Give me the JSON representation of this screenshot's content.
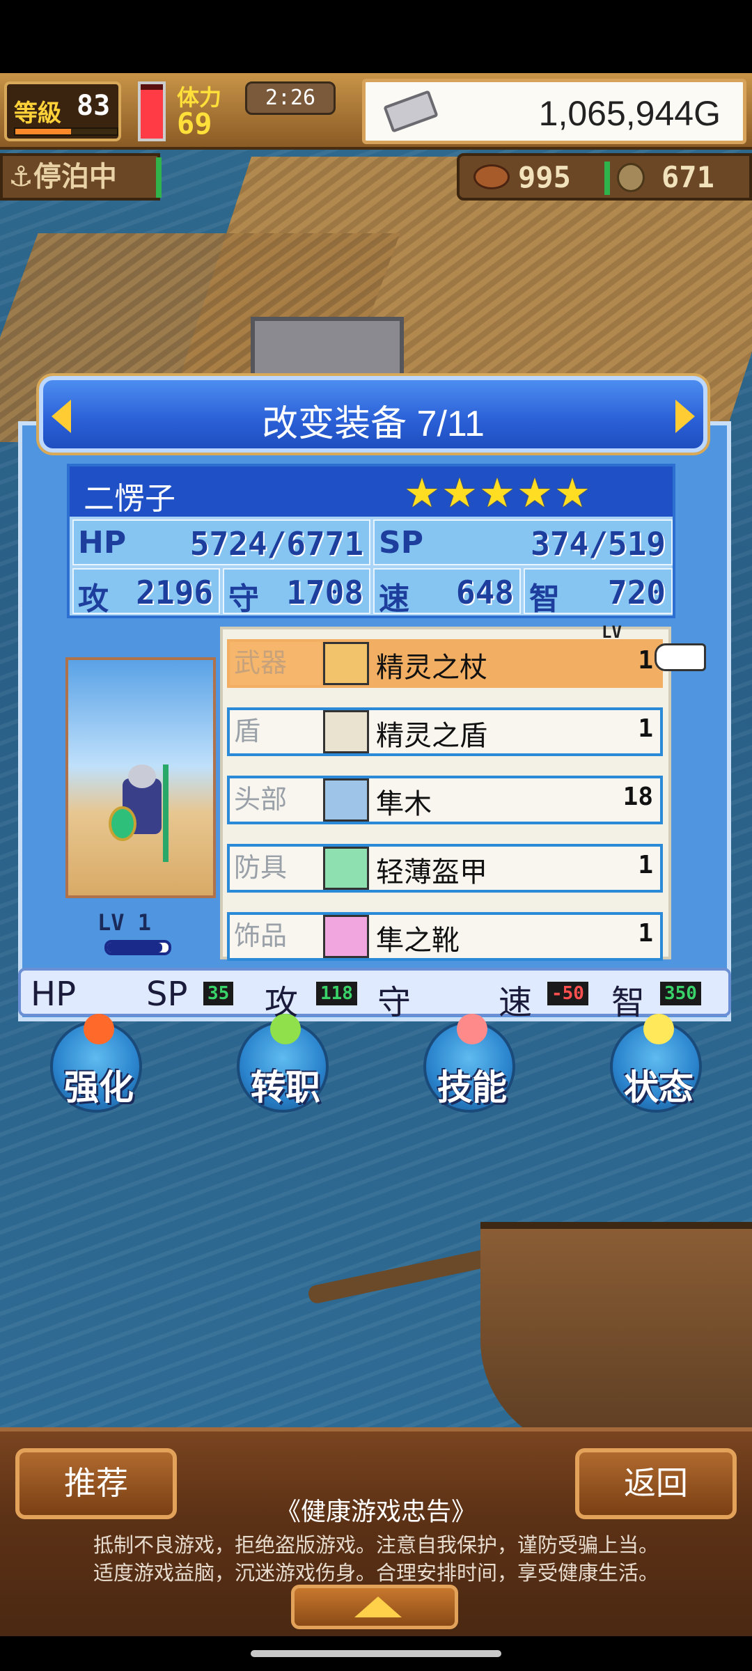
{
  "hud": {
    "level_label": "等級",
    "level_value": "83",
    "exp_fraction": 0.55,
    "stamina_label": "体力",
    "stamina_value": "69",
    "stamina_fraction": 0.9,
    "time": "2:26",
    "gold": "1,065,944G",
    "status": "停泊中",
    "food": "995",
    "wood": "671"
  },
  "dialog": {
    "title": "改变装备 7/11",
    "character": {
      "name": "二愣子",
      "stars": "★★★★★",
      "star_count": 5,
      "hp_label": "HP",
      "hp": "5724/6771",
      "sp_label": "SP",
      "sp": "374/519",
      "atk_label": "攻",
      "atk": "2196",
      "def_label": "守",
      "def": "1708",
      "spd_label": "速",
      "spd": "648",
      "int_label": "智",
      "int": "720",
      "lv_tag": "LV  1",
      "lv_fraction": 0.9
    },
    "equipment": {
      "lv_header": "LV",
      "slots": [
        {
          "slot": "武器",
          "item": "精灵之杖",
          "level": "1",
          "icon": "staff-icon",
          "icon_color": "#f2c36a"
        },
        {
          "slot": "盾",
          "item": "精灵之盾",
          "level": "1",
          "icon": "shield-icon",
          "icon_color": "#e9e3cf"
        },
        {
          "slot": "头部",
          "item": "隼木",
          "level": "18",
          "icon": "helmet-icon",
          "icon_color": "#9ec4e8"
        },
        {
          "slot": "防具",
          "item": "轻薄盔甲",
          "level": "1",
          "icon": "armor-icon",
          "icon_color": "#8fe0b0"
        },
        {
          "slot": "饰品",
          "item": "隼之靴",
          "level": "1",
          "icon": "boots-icon",
          "icon_color": "#f2a6e0"
        }
      ]
    },
    "bonus": {
      "hp_label": "HP",
      "sp_label": "SP",
      "sp_value": "35",
      "atk_label": "攻",
      "atk_value": "118",
      "def_label": "守",
      "spd_label": "速",
      "spd_value": "-50",
      "int_label": "智",
      "int_value": "350"
    }
  },
  "actions": [
    {
      "label": "强化",
      "icon": "arrow-up-icon",
      "color": "#ff6a2a"
    },
    {
      "label": "转职",
      "icon": "leaf-icon",
      "color": "#8fe04a"
    },
    {
      "label": "技能",
      "icon": "flame-icon",
      "color": "#ff8a8a"
    },
    {
      "label": "状态",
      "icon": "sparkle-icon",
      "color": "#ffe95a"
    }
  ],
  "footer": {
    "recommend": "推荐",
    "back": "返回",
    "notice_title": "《健康游戏忠告》",
    "notice_line1": "抵制不良游戏，拒绝盗版游戏。注意自我保护，谨防受骗上当。",
    "notice_line2": "适度游戏益脑，沉迷游戏伤身。合理安排时间，享受健康生活。"
  },
  "colors": {
    "dialog_blue": "#4f95df",
    "title_blue": "#2a5fd6",
    "selected_row": "#f2ae62",
    "gold_accent": "#ffdd22"
  }
}
